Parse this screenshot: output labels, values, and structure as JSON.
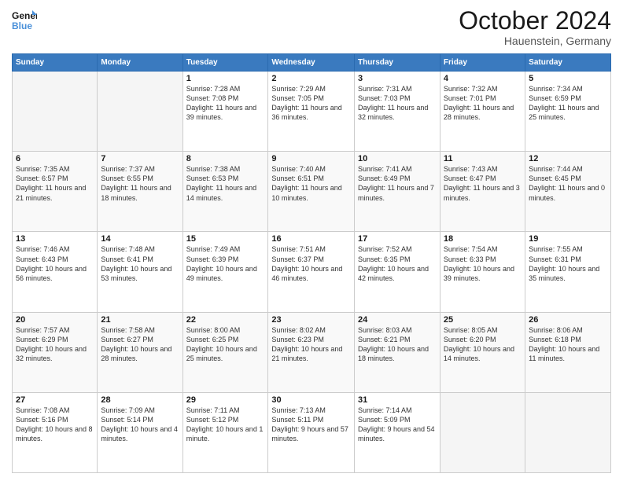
{
  "header": {
    "logo_line1": "General",
    "logo_line2": "Blue",
    "month": "October 2024",
    "location": "Hauenstein, Germany"
  },
  "days_of_week": [
    "Sunday",
    "Monday",
    "Tuesday",
    "Wednesday",
    "Thursday",
    "Friday",
    "Saturday"
  ],
  "weeks": [
    [
      {
        "day": "",
        "info": ""
      },
      {
        "day": "",
        "info": ""
      },
      {
        "day": "1",
        "info": "Sunrise: 7:28 AM\nSunset: 7:08 PM\nDaylight: 11 hours and 39 minutes."
      },
      {
        "day": "2",
        "info": "Sunrise: 7:29 AM\nSunset: 7:05 PM\nDaylight: 11 hours and 36 minutes."
      },
      {
        "day": "3",
        "info": "Sunrise: 7:31 AM\nSunset: 7:03 PM\nDaylight: 11 hours and 32 minutes."
      },
      {
        "day": "4",
        "info": "Sunrise: 7:32 AM\nSunset: 7:01 PM\nDaylight: 11 hours and 28 minutes."
      },
      {
        "day": "5",
        "info": "Sunrise: 7:34 AM\nSunset: 6:59 PM\nDaylight: 11 hours and 25 minutes."
      }
    ],
    [
      {
        "day": "6",
        "info": "Sunrise: 7:35 AM\nSunset: 6:57 PM\nDaylight: 11 hours and 21 minutes."
      },
      {
        "day": "7",
        "info": "Sunrise: 7:37 AM\nSunset: 6:55 PM\nDaylight: 11 hours and 18 minutes."
      },
      {
        "day": "8",
        "info": "Sunrise: 7:38 AM\nSunset: 6:53 PM\nDaylight: 11 hours and 14 minutes."
      },
      {
        "day": "9",
        "info": "Sunrise: 7:40 AM\nSunset: 6:51 PM\nDaylight: 11 hours and 10 minutes."
      },
      {
        "day": "10",
        "info": "Sunrise: 7:41 AM\nSunset: 6:49 PM\nDaylight: 11 hours and 7 minutes."
      },
      {
        "day": "11",
        "info": "Sunrise: 7:43 AM\nSunset: 6:47 PM\nDaylight: 11 hours and 3 minutes."
      },
      {
        "day": "12",
        "info": "Sunrise: 7:44 AM\nSunset: 6:45 PM\nDaylight: 11 hours and 0 minutes."
      }
    ],
    [
      {
        "day": "13",
        "info": "Sunrise: 7:46 AM\nSunset: 6:43 PM\nDaylight: 10 hours and 56 minutes."
      },
      {
        "day": "14",
        "info": "Sunrise: 7:48 AM\nSunset: 6:41 PM\nDaylight: 10 hours and 53 minutes."
      },
      {
        "day": "15",
        "info": "Sunrise: 7:49 AM\nSunset: 6:39 PM\nDaylight: 10 hours and 49 minutes."
      },
      {
        "day": "16",
        "info": "Sunrise: 7:51 AM\nSunset: 6:37 PM\nDaylight: 10 hours and 46 minutes."
      },
      {
        "day": "17",
        "info": "Sunrise: 7:52 AM\nSunset: 6:35 PM\nDaylight: 10 hours and 42 minutes."
      },
      {
        "day": "18",
        "info": "Sunrise: 7:54 AM\nSunset: 6:33 PM\nDaylight: 10 hours and 39 minutes."
      },
      {
        "day": "19",
        "info": "Sunrise: 7:55 AM\nSunset: 6:31 PM\nDaylight: 10 hours and 35 minutes."
      }
    ],
    [
      {
        "day": "20",
        "info": "Sunrise: 7:57 AM\nSunset: 6:29 PM\nDaylight: 10 hours and 32 minutes."
      },
      {
        "day": "21",
        "info": "Sunrise: 7:58 AM\nSunset: 6:27 PM\nDaylight: 10 hours and 28 minutes."
      },
      {
        "day": "22",
        "info": "Sunrise: 8:00 AM\nSunset: 6:25 PM\nDaylight: 10 hours and 25 minutes."
      },
      {
        "day": "23",
        "info": "Sunrise: 8:02 AM\nSunset: 6:23 PM\nDaylight: 10 hours and 21 minutes."
      },
      {
        "day": "24",
        "info": "Sunrise: 8:03 AM\nSunset: 6:21 PM\nDaylight: 10 hours and 18 minutes."
      },
      {
        "day": "25",
        "info": "Sunrise: 8:05 AM\nSunset: 6:20 PM\nDaylight: 10 hours and 14 minutes."
      },
      {
        "day": "26",
        "info": "Sunrise: 8:06 AM\nSunset: 6:18 PM\nDaylight: 10 hours and 11 minutes."
      }
    ],
    [
      {
        "day": "27",
        "info": "Sunrise: 7:08 AM\nSunset: 5:16 PM\nDaylight: 10 hours and 8 minutes."
      },
      {
        "day": "28",
        "info": "Sunrise: 7:09 AM\nSunset: 5:14 PM\nDaylight: 10 hours and 4 minutes."
      },
      {
        "day": "29",
        "info": "Sunrise: 7:11 AM\nSunset: 5:12 PM\nDaylight: 10 hours and 1 minute."
      },
      {
        "day": "30",
        "info": "Sunrise: 7:13 AM\nSunset: 5:11 PM\nDaylight: 9 hours and 57 minutes."
      },
      {
        "day": "31",
        "info": "Sunrise: 7:14 AM\nSunset: 5:09 PM\nDaylight: 9 hours and 54 minutes."
      },
      {
        "day": "",
        "info": ""
      },
      {
        "day": "",
        "info": ""
      }
    ]
  ]
}
